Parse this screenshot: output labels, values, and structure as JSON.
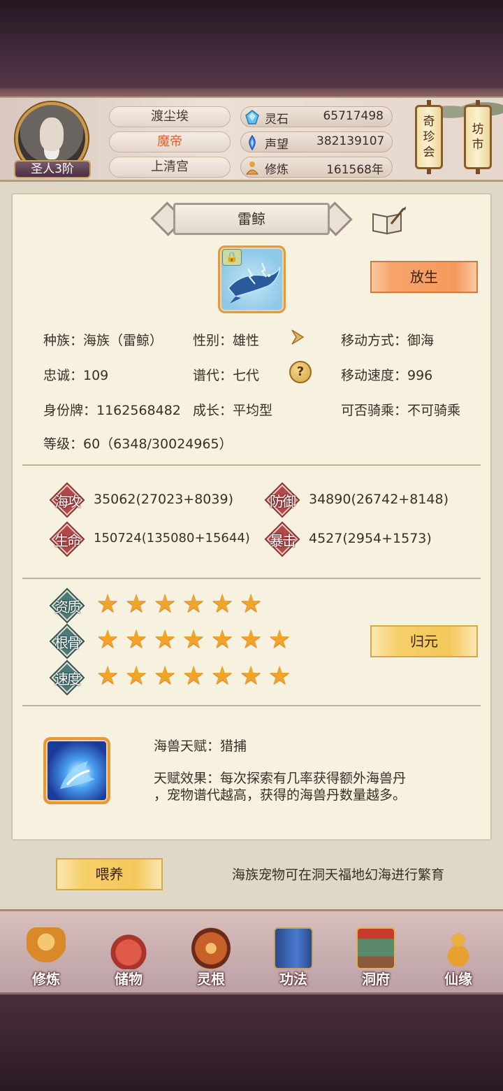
{
  "header": {
    "rank": "圣人3阶",
    "names": [
      "渡尘埃",
      "魔帝",
      "上清宫"
    ],
    "resources": [
      {
        "icon": "spirit-stone-icon",
        "label": "灵石",
        "value": "65717498"
      },
      {
        "icon": "prestige-icon",
        "label": "声望",
        "value": "382139107"
      },
      {
        "icon": "cultivation-icon",
        "label": "修炼",
        "value": "161568年"
      }
    ],
    "side_buttons": [
      {
        "lines": [
          "奇",
          "珍",
          "会"
        ]
      },
      {
        "lines": [
          "坊",
          "市"
        ]
      }
    ]
  },
  "pet": {
    "title": "雷鲸",
    "release_label": "放生",
    "info": {
      "race": "种族：海族（雷鲸）",
      "gender": "性别：雄性",
      "move_mode": "移动方式：御海",
      "loyalty": "忠诚：109",
      "generation": "谱代：七代",
      "move_speed": "移动速度：996",
      "id_tag": "身份牌：1162568482",
      "growth": "成长：平均型",
      "rideable": "可否骑乘：不可骑乘",
      "level": "等级：60（6348/30024965）"
    },
    "stats": [
      {
        "label": "海攻",
        "value": "35062(27023+8039)"
      },
      {
        "label": "防御",
        "value": "34890(26742+8148)"
      },
      {
        "label": "生命",
        "value": "150724(135080+15644)"
      },
      {
        "label": "暴击",
        "value": "4527(2954+1573)"
      }
    ],
    "qualities": [
      {
        "label": "资质",
        "stars": 6
      },
      {
        "label": "根骨",
        "stars": 7
      },
      {
        "label": "速度",
        "stars": 7
      }
    ],
    "reset_label": "归元",
    "talent": {
      "name": "海兽天赋：猎捕",
      "effect_line1": "天赋效果：每次探索有几率获得额外海兽丹",
      "effect_line2": "，宠物谱代越高，获得的海兽丹数量越多。"
    },
    "feed_label": "喂养",
    "footer_note": "海族宠物可在洞天福地幻海进行繁育"
  },
  "nav": [
    {
      "label": "修炼",
      "icon": "monk-icon",
      "color": "#e0a040"
    },
    {
      "label": "储物",
      "icon": "bag-icon",
      "color": "#c8443c"
    },
    {
      "label": "灵根",
      "icon": "spirit-root-icon",
      "color": "#b8502a"
    },
    {
      "label": "功法",
      "icon": "book-icon",
      "color": "#3a6ab0"
    },
    {
      "label": "洞府",
      "icon": "palace-icon",
      "color": "#8a5a3a"
    },
    {
      "label": "仙缘",
      "icon": "gourd-icon",
      "color": "#d89a3a"
    }
  ]
}
